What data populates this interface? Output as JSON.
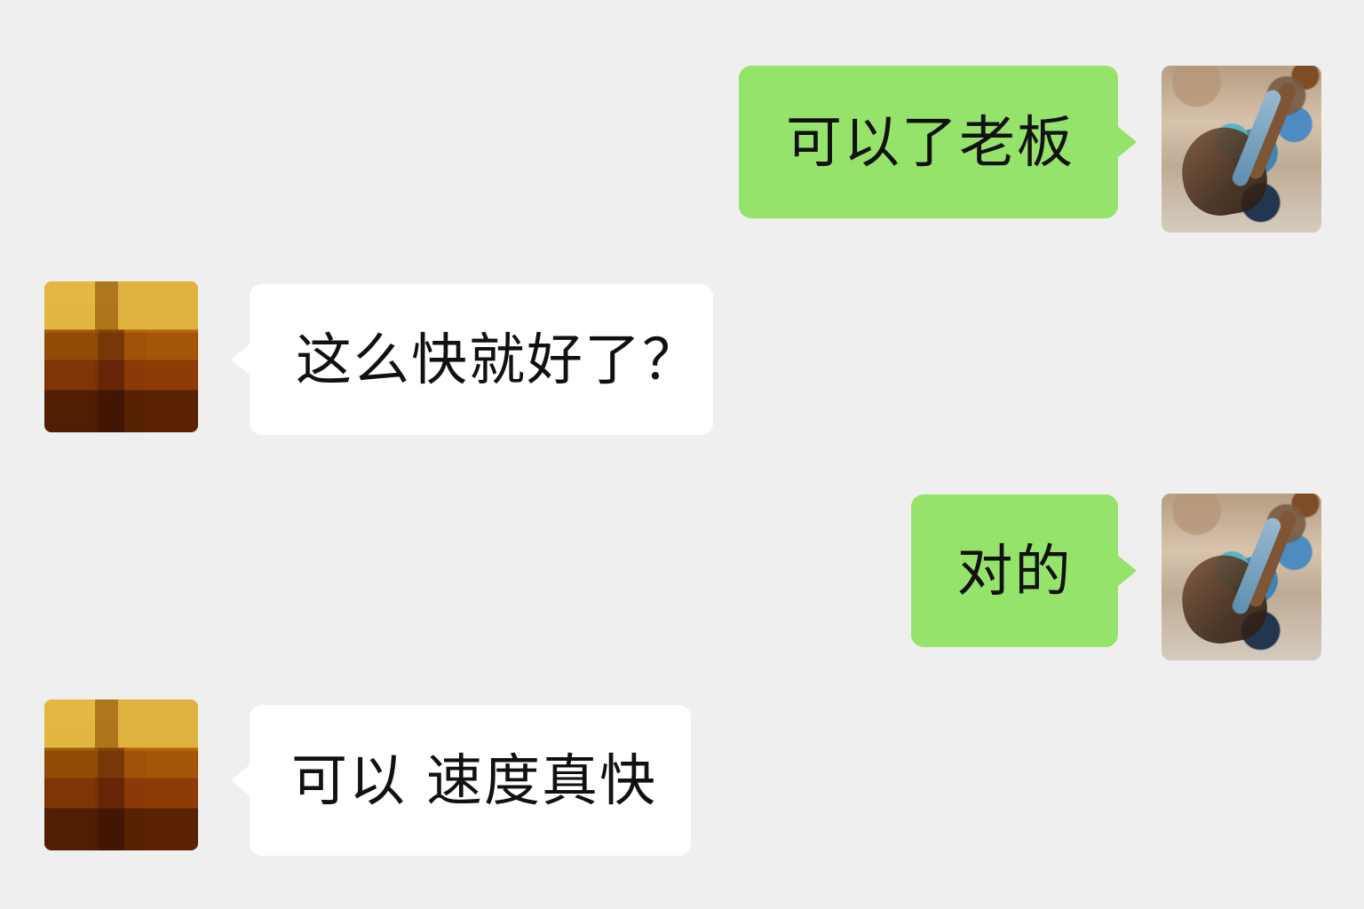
{
  "messages": [
    {
      "side": "self",
      "text": "可以了老板",
      "avatar": "traveler-photo"
    },
    {
      "side": "other",
      "text": "这么快就好了？",
      "avatar": "pixelated-profile-photo"
    },
    {
      "side": "self",
      "text": "对的",
      "avatar": "traveler-photo"
    },
    {
      "side": "other",
      "text": "可以 速度真快",
      "avatar": "pixelated-profile-photo"
    }
  ],
  "colors": {
    "background": "#efefef",
    "self_bubble": "#95e36a",
    "other_bubble": "#ffffff",
    "text": "#111111"
  }
}
